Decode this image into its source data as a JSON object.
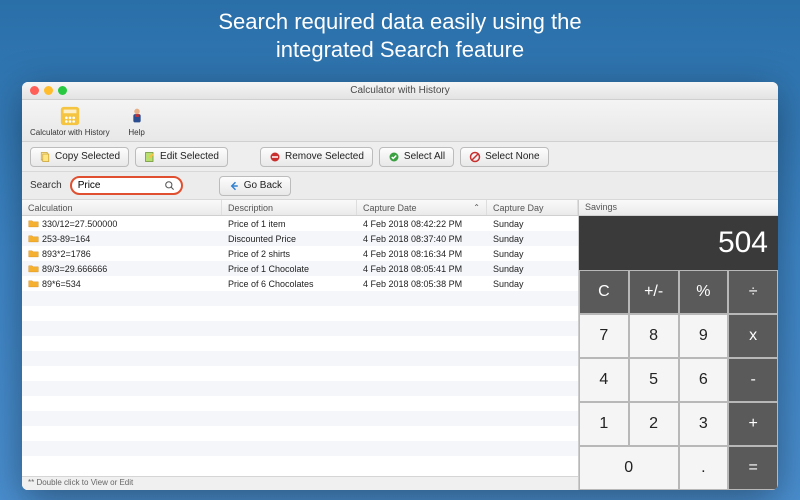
{
  "banner": {
    "line1": "Search required data easily using the",
    "line2": "integrated Search feature"
  },
  "window": {
    "title": "Calculator with History"
  },
  "appbar": {
    "app_label": "Calculator with History",
    "help_label": "Help"
  },
  "toolbar": {
    "copy": "Copy Selected",
    "edit": "Edit Selected",
    "remove": "Remove Selected",
    "select_all": "Select All",
    "select_none": "Select None"
  },
  "search": {
    "label": "Search",
    "value": "Price",
    "goback": "Go Back"
  },
  "columns": {
    "c1": "Calculation",
    "c2": "Description",
    "c3": "Capture Date",
    "c4": "Capture Day"
  },
  "rows": [
    {
      "calc": "330/12=27.500000",
      "desc": "Price of 1 item",
      "date": "4 Feb 2018 08:42:22 PM",
      "day": "Sunday"
    },
    {
      "calc": "253-89=164",
      "desc": "Discounted Price",
      "date": "4 Feb 2018 08:37:40 PM",
      "day": "Sunday"
    },
    {
      "calc": "893*2=1786",
      "desc": "Price of 2 shirts",
      "date": "4 Feb 2018 08:16:34 PM",
      "day": "Sunday"
    },
    {
      "calc": "89/3=29.666666",
      "desc": "Price of 1 Chocolate",
      "date": "4 Feb 2018 08:05:41 PM",
      "day": "Sunday"
    },
    {
      "calc": "89*6=534",
      "desc": "Price of 6 Chocolates",
      "date": "4 Feb 2018 08:05:38 PM",
      "day": "Sunday"
    }
  ],
  "footer": "** Double click to View or Edit",
  "calc": {
    "header": "Savings",
    "display": "504",
    "keys": [
      {
        "l": "C",
        "cls": "dark"
      },
      {
        "l": "+/-",
        "cls": "dark"
      },
      {
        "l": "%",
        "cls": "dark"
      },
      {
        "l": "÷",
        "cls": "dark"
      },
      {
        "l": "7"
      },
      {
        "l": "8"
      },
      {
        "l": "9"
      },
      {
        "l": "x",
        "cls": "dark"
      },
      {
        "l": "4"
      },
      {
        "l": "5"
      },
      {
        "l": "6"
      },
      {
        "l": "-",
        "cls": "dark"
      },
      {
        "l": "1"
      },
      {
        "l": "2"
      },
      {
        "l": "3"
      },
      {
        "l": "+",
        "cls": "dark"
      },
      {
        "l": "0",
        "span": 2
      },
      {
        "l": "."
      },
      {
        "l": "=",
        "cls": "dark"
      }
    ]
  }
}
